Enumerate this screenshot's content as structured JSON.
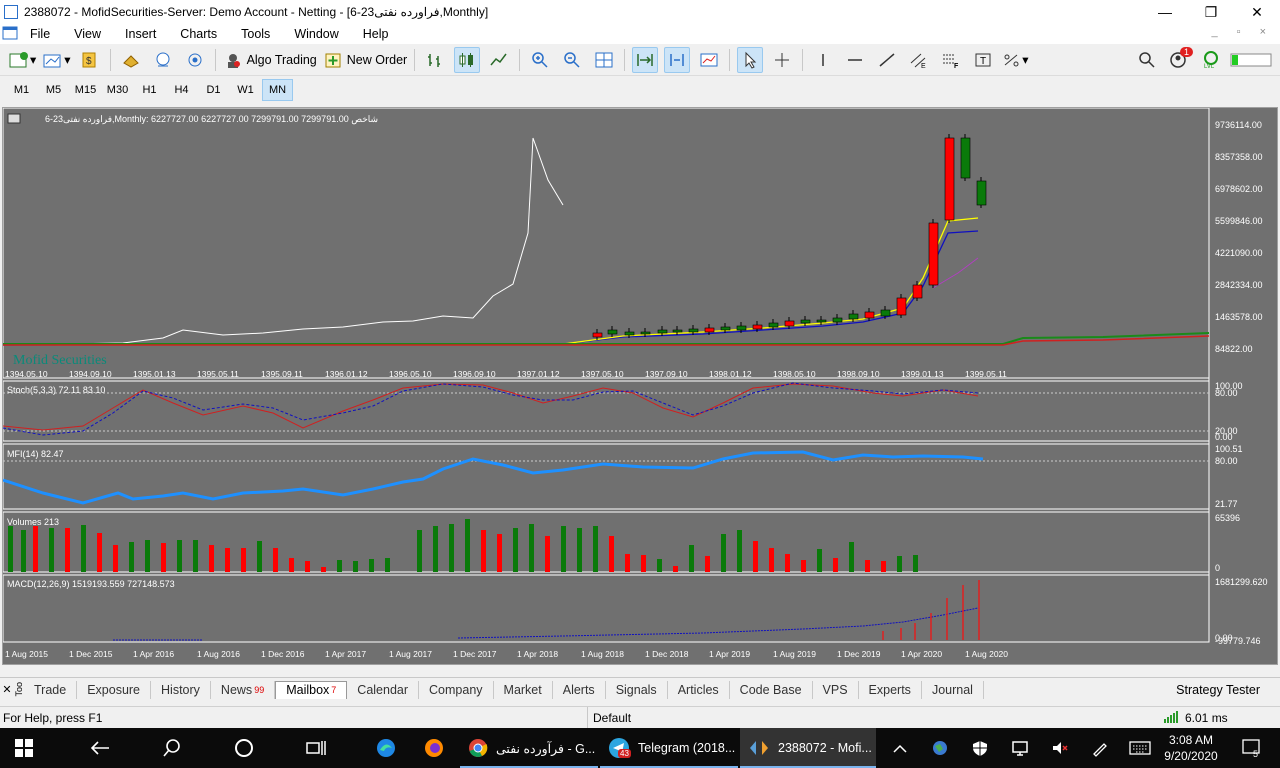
{
  "window": {
    "title": "2388072 - MofidSecurities-Server: Demo Account - Netting - [فراورده نفتی23-6,Monthly]",
    "minimize": "—",
    "maximize": "❐",
    "close": "✕"
  },
  "menu": [
    "File",
    "View",
    "Insert",
    "Charts",
    "Tools",
    "Window",
    "Help"
  ],
  "toolbar": {
    "algo_trading": "Algo Trading",
    "new_order": "New Order"
  },
  "notifications_count": "1",
  "timeframes": [
    "M1",
    "M5",
    "M15",
    "M30",
    "H1",
    "H4",
    "D1",
    "W1",
    "MN"
  ],
  "active_timeframe": "MN",
  "chart": {
    "header": "فراورده نفتی23-6,Monthly:  6227727.00 6227727.00 7299791.00 7299791.00  شاخص",
    "watermark": "Mofid Securities",
    "price_labels": [
      "9736114.00",
      "8357358.00",
      "6978602.00",
      "5599846.00",
      "4221090.00",
      "2842334.00",
      "1463578.00",
      "84822.00"
    ],
    "top_dates": [
      "1394.05.10",
      "1394.09.10",
      "1395.01.13",
      "1395.05.11",
      "1395.09.11",
      "1396.01.12",
      "1396.05.10",
      "1396.09.10",
      "1397.01.12",
      "1397.05.10",
      "1397.09.10",
      "1398.01.12",
      "1398.05.10",
      "1398.09.10",
      "1399.01.13",
      "1399.05.11"
    ],
    "bottom_dates": [
      "1 Aug 2015",
      "1 Dec 2015",
      "1 Apr 2016",
      "1 Aug 2016",
      "1 Dec 2016",
      "1 Apr 2017",
      "1 Aug 2017",
      "1 Dec 2017",
      "1 Apr 2018",
      "1 Aug 2018",
      "1 Dec 2018",
      "1 Apr 2019",
      "1 Aug 2019",
      "1 Dec 2019",
      "1 Apr 2020",
      "1 Aug 2020"
    ],
    "stoch": {
      "label": "Stoch(5,3,3) 72.11 83.10",
      "levels": [
        "100.00",
        "80.00",
        "20.00",
        "0.00"
      ]
    },
    "mfi": {
      "label": "MFI(14) 82.47",
      "levels": [
        "100.51",
        "80.00",
        "21.77"
      ]
    },
    "volumes": {
      "label": "Volumes 213",
      "levels": [
        "65396",
        "0"
      ]
    },
    "macd": {
      "label": "MACD(12,26,9) 1519193.559 727148.573",
      "levels": [
        "1681299.620",
        "0.00",
        "-99779.746"
      ]
    }
  },
  "tabs": [
    "Trade",
    "Exposure",
    "History",
    "News",
    "Mailbox",
    "Calendar",
    "Company",
    "Market",
    "Alerts",
    "Signals",
    "Articles",
    "Code Base",
    "VPS",
    "Experts",
    "Journal"
  ],
  "tab_badges": {
    "News": "99",
    "Mailbox": "7"
  },
  "active_tab": "Mailbox",
  "strategy_tester": "Strategy Tester",
  "toolbox_label": "Too",
  "status": {
    "help": "For Help, press F1",
    "profile": "Default",
    "ping": "6.01 ms"
  },
  "taskbar": {
    "apps": [
      "فرآورده نفتی - G...",
      "Telegram (2018...",
      "2388072 - Mofi..."
    ],
    "telegram_badge": "43",
    "time": "3:08 AM",
    "date": "9/20/2020",
    "notif": "5"
  },
  "colors": {
    "chart_bg": "#707070",
    "bull": "#0a7a0a",
    "bear": "#ff0000",
    "ma_yellow": "#ffff00",
    "ma_blue": "#1010c0",
    "mfi": "#1e90ff"
  }
}
